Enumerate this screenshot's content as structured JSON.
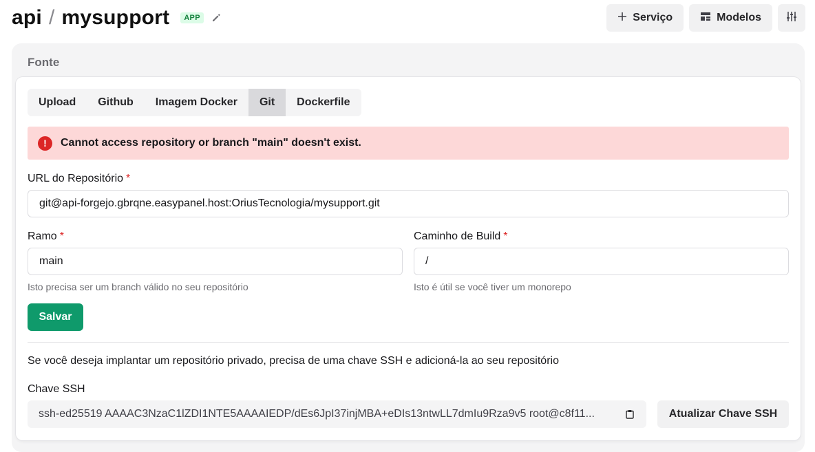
{
  "header": {
    "project": "api",
    "separator": "/",
    "service": "mysupport",
    "badge": "APP",
    "actions": {
      "service_label": "Serviço",
      "templates_label": "Modelos"
    }
  },
  "source": {
    "section_title": "Fonte",
    "tabs": [
      {
        "label": "Upload"
      },
      {
        "label": "Github"
      },
      {
        "label": "Imagem Docker"
      },
      {
        "label": "Git"
      },
      {
        "label": "Dockerfile"
      }
    ],
    "active_tab": "Git",
    "alert": {
      "message": "Cannot access repository or branch \"main\" doesn't exist."
    },
    "repo_url": {
      "label": "URL do Repositório",
      "required_mark": "*",
      "value": "git@api-forgejo.gbrqne.easypanel.host:OriusTecnologia/mysupport.git"
    },
    "branch": {
      "label": "Ramo",
      "required_mark": "*",
      "value": "main",
      "hint": "Isto precisa ser um branch válido no seu repositório"
    },
    "build_path": {
      "label": "Caminho de Build",
      "required_mark": "*",
      "value": "/",
      "hint": "Isto é útil se você tiver um monorepo"
    },
    "save_label": "Salvar",
    "private_info": "Se você deseja implantar um repositório privado, precisa de uma chave SSH e adicioná-la ao seu repositório",
    "ssh": {
      "label": "Chave SSH",
      "value": "ssh-ed25519 AAAAC3NzaC1lZDI1NTE5AAAAIEDP/dEs6JpI37injMBA+eDIs13ntwLL7dmIu9Rza9v5 root@c8f11...",
      "refresh_label": "Atualizar Chave SSH"
    }
  },
  "colors": {
    "accent": "#0f9a6b",
    "danger": "#dc2626",
    "alert_bg": "#fdd8d8"
  }
}
